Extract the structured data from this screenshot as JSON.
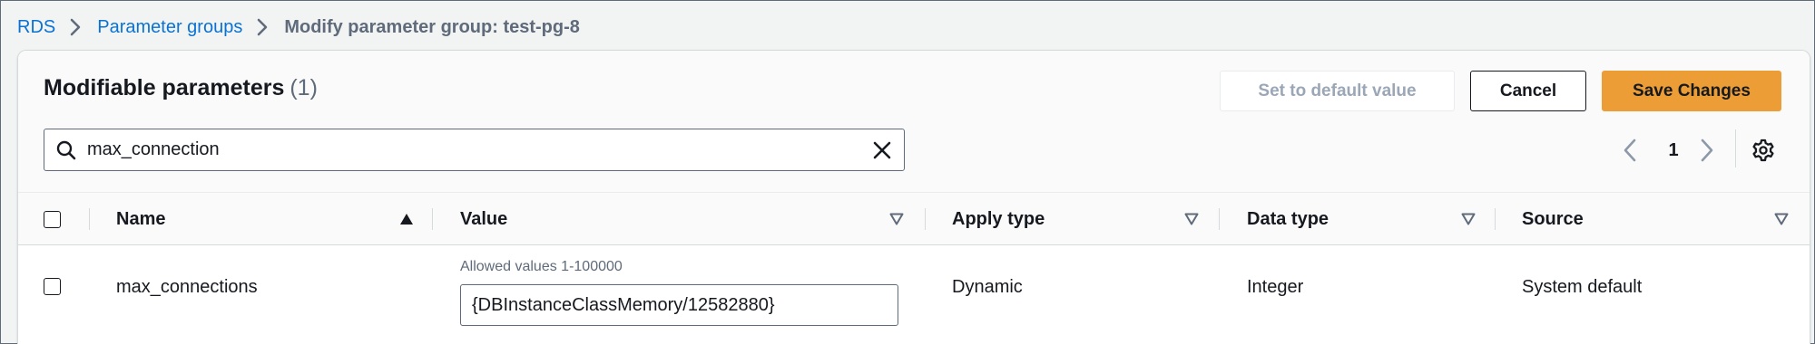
{
  "breadcrumb": {
    "items": [
      "RDS",
      "Parameter groups"
    ],
    "current": "Modify parameter group: test-pg-8"
  },
  "panel": {
    "title": "Modifiable parameters",
    "count": "(1)",
    "buttons": {
      "set_default": "Set to default value",
      "cancel": "Cancel",
      "save": "Save Changes"
    },
    "search": {
      "value": "max_connection",
      "placeholder": ""
    },
    "pagination": {
      "current_page": "1"
    }
  },
  "table": {
    "columns": [
      "Name",
      "Value",
      "Apply type",
      "Data type",
      "Source"
    ],
    "sorted_column": "Name",
    "rows": [
      {
        "name": "max_connections",
        "value_hint": "Allowed values 1-100000",
        "value": "{DBInstanceClassMemory/12582880}",
        "apply_type": "Dynamic",
        "data_type": "Integer",
        "source": "System default"
      }
    ]
  },
  "colors": {
    "link": "#0972d3",
    "primary_button": "#ec9d36",
    "disabled_text": "#9ba7b6"
  }
}
